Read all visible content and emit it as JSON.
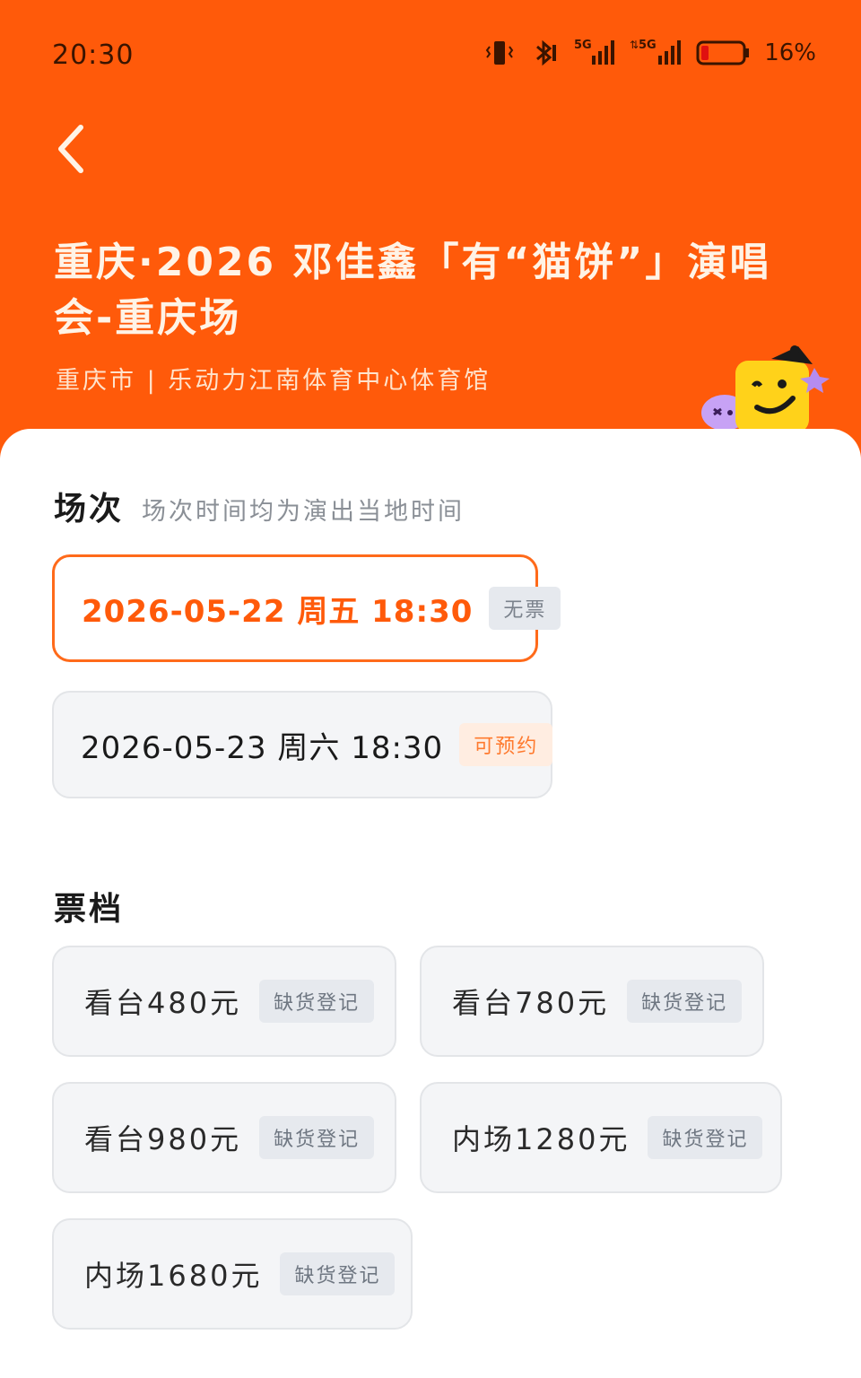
{
  "status_bar": {
    "time": "20:30",
    "network_1": "5G",
    "network_2": "5G",
    "battery": "16%"
  },
  "header": {
    "title": "重庆·2026 邓佳鑫「有“猫饼”」演唱会-重庆场",
    "subtitle": "重庆市 | 乐动力江南体育中心体育馆"
  },
  "sessions": {
    "title": "场次",
    "note": "场次时间均为演出当地时间",
    "items": [
      {
        "label": "2026-05-22 周五 18:30",
        "tag": "无票",
        "selected": true
      },
      {
        "label": "2026-05-23 周六 18:30",
        "tag": "可预约",
        "selected": false
      }
    ]
  },
  "tiers": {
    "title": "票档",
    "items": [
      {
        "label": "看台480元",
        "tag": "缺货登记"
      },
      {
        "label": "看台780元",
        "tag": "缺货登记"
      },
      {
        "label": "看台980元",
        "tag": "缺货登记"
      },
      {
        "label": "内场1280元",
        "tag": "缺货登记"
      },
      {
        "label": "内场1680元",
        "tag": "缺货登记"
      }
    ]
  },
  "colors": {
    "brand_orange": "#FF5A0A",
    "selected_border": "#FF6A1A",
    "card_bg": "#F4F5F7"
  }
}
